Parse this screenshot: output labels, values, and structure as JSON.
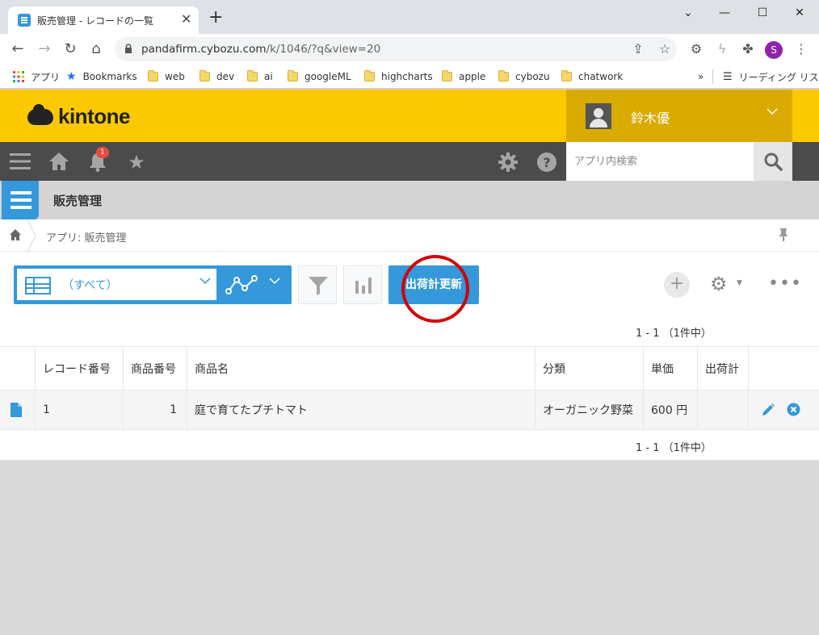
{
  "browser": {
    "tab_title": "販売管理 - レコードの一覧",
    "url_host": "pandafirm.cybozu.com",
    "url_path": "/k/1046/?q&view=20",
    "bookmarks": [
      "アプリ",
      "Bookmarks",
      "web",
      "dev",
      "ai",
      "googleML",
      "highcharts",
      "apple",
      "cybozu",
      "chatwork"
    ],
    "reading_list": "リーディング リスト",
    "profile_initial": "S"
  },
  "kintone": {
    "logo": "kintone",
    "user_name": "鈴木優",
    "notification_count": "1",
    "search_placeholder": "アプリ内検索",
    "app_name": "販売管理",
    "breadcrumb": "アプリ: 販売管理",
    "view_name": "（すべて）",
    "update_button": "出荷計更新",
    "pager_top": "1 - 1 （1件中）",
    "pager_bottom": "1 - 1 （1件中）"
  },
  "table": {
    "headers": [
      "レコード番号",
      "商品番号",
      "商品名",
      "分類",
      "単価",
      "出荷計"
    ],
    "rows": [
      [
        "1",
        "1",
        "庭で育てたプチトマト",
        "オーガニック野菜",
        "600 円",
        ""
      ]
    ]
  },
  "colors": {
    "kintone_yellow": "#fcc800",
    "kintone_blue": "#3498db",
    "highlight_red": "#d40000"
  }
}
